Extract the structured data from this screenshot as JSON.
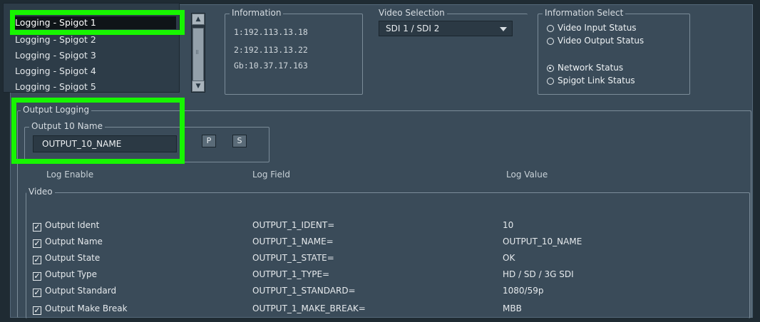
{
  "spigots": {
    "items": [
      "Logging - Spigot 1",
      "Logging - Spigot 2",
      "Logging - Spigot 3",
      "Logging - Spigot 4",
      "Logging - Spigot 5"
    ],
    "selected_index": 0
  },
  "information": {
    "legend": "Information",
    "lines": [
      "1:192.113.13.18",
      "2:192.113.13.22",
      "Gb:10.37.17.163"
    ]
  },
  "video_selection": {
    "legend": "Video Selection",
    "value": "SDI 1 / SDI 2"
  },
  "information_select": {
    "legend": "Information Select",
    "options": [
      "Video Input Status",
      "Video Output Status",
      "Network Status",
      "Spigot Link Status"
    ],
    "selected": "Network Status"
  },
  "output_logging": {
    "legend": "Output Logging",
    "name_legend": "Output 10 Name",
    "name_value": "OUTPUT_10_NAME",
    "p_label": "P",
    "s_label": "S"
  },
  "table": {
    "headers": [
      "Log Enable",
      "Log Field",
      "Log Value"
    ],
    "group_legend": "Video",
    "rows": [
      {
        "enable": "Output Ident",
        "field": "OUTPUT_1_IDENT=",
        "value": "10",
        "checked": true
      },
      {
        "enable": "Output Name",
        "field": "OUTPUT_1_NAME=",
        "value": "OUTPUT_10_NAME",
        "checked": true
      },
      {
        "enable": "Output State",
        "field": "OUTPUT_1_STATE=",
        "value": "OK",
        "checked": true
      },
      {
        "enable": "Output Type",
        "field": "OUTPUT_1_TYPE=",
        "value": "HD / SD / 3G SDI",
        "checked": true
      },
      {
        "enable": "Output Standard",
        "field": "OUTPUT_1_STANDARD=",
        "value": "1080/59p",
        "checked": true
      },
      {
        "enable": "Output Make Break",
        "field": "OUTPUT_1_MAKE_BREAK=",
        "value": "MBB",
        "checked": true
      }
    ]
  },
  "colors": {
    "highlight": "#17f500",
    "panel": "#3a4b59"
  }
}
